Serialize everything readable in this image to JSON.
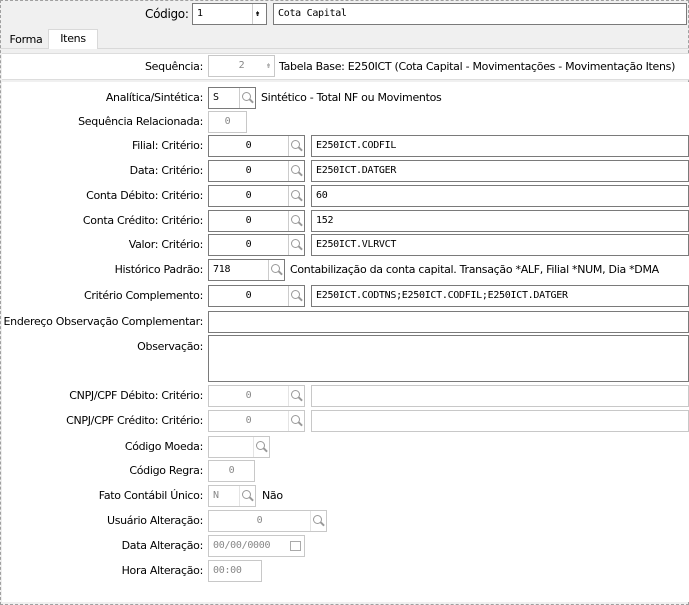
{
  "header": {
    "codigo_label": "Código:",
    "codigo_value": "1",
    "descricao_value": "Cota Capital"
  },
  "tabs": [
    {
      "label": "Forma"
    },
    {
      "label": "Itens"
    }
  ],
  "sequencia": {
    "label": "Sequência:",
    "value": "2",
    "tabela_base": "Tabela Base: E250ICT (Cota Capital - Movimentações - Movimentação Itens)"
  },
  "analitica": {
    "label": "Analítica/Sintética:",
    "value": "S",
    "description": "Sintético - Total NF ou Movimentos"
  },
  "seq_relacionada": {
    "label": "Sequência Relacionada:",
    "value": "0"
  },
  "criterios": [
    {
      "label": "Filial: Critério:",
      "value": "0",
      "expr": "E250ICT.CODFIL",
      "enabled": true
    },
    {
      "label": "Data: Critério:",
      "value": "0",
      "expr": "E250ICT.DATGER",
      "enabled": true
    },
    {
      "label": "Conta Débito: Critério:",
      "value": "0",
      "expr": "60",
      "enabled": true
    },
    {
      "label": "Conta Crédito: Critério:",
      "value": "0",
      "expr": "152",
      "enabled": true
    },
    {
      "label": "Valor: Critério:",
      "value": "0",
      "expr": "E250ICT.VLRVCT",
      "enabled": true
    }
  ],
  "historico": {
    "label": "Histórico Padrão:",
    "value": "718",
    "description": "Contabilização da conta capital. Transação *ALF, Filial *NUM, Dia *DMA"
  },
  "criterio_complemento": {
    "label": "Critério Complemento:",
    "value": "0",
    "expr": "E250ICT.CODTNS;E250ICT.CODFIL;E250ICT.DATGER"
  },
  "endereco_obs": {
    "label": "Endereço Observação Complementar:",
    "value": ""
  },
  "observacao": {
    "label": "Observação:",
    "value": ""
  },
  "cnpj_debito": {
    "label": "CNPJ/CPF Débito: Critério:",
    "value": "0",
    "expr": ""
  },
  "cnpj_credito": {
    "label": "CNPJ/CPF Crédito: Critério:",
    "value": "0",
    "expr": ""
  },
  "codigo_moeda": {
    "label": "Código Moeda:",
    "value": ""
  },
  "codigo_regra": {
    "label": "Código Regra:",
    "value": "0"
  },
  "fato_contabil": {
    "label": "Fato Contábil Único:",
    "value": "N",
    "description": "Não"
  },
  "usuario_alteracao": {
    "label": "Usuário Alteração:",
    "value": "0"
  },
  "data_alteracao": {
    "label": "Data Alteração:",
    "value": "00/00/0000"
  },
  "hora_alteracao": {
    "label": "Hora Alteração:",
    "value": "00:00"
  }
}
